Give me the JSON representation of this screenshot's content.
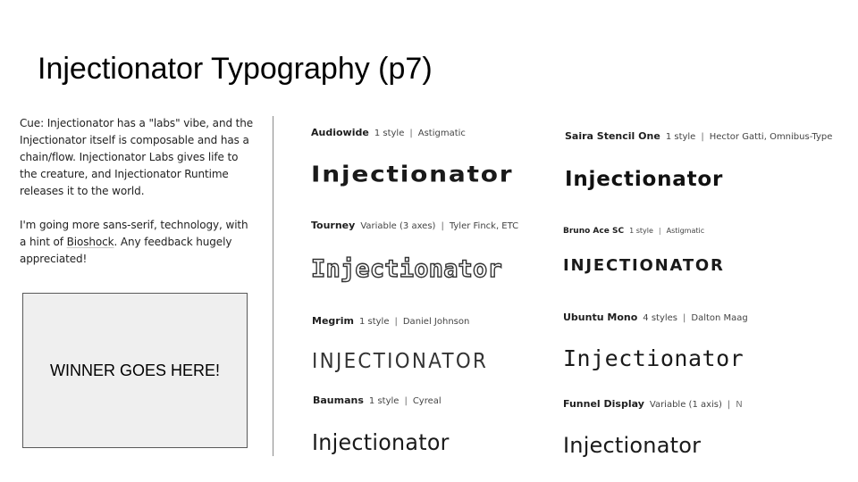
{
  "slide": {
    "title": "Injectionator Typography (p7)"
  },
  "cue": {
    "paragraph1": "Cue: Injectionator has a \"labs\" vibe, and the Injectionator itself is composable and has a chain/flow. Injectionator Labs gives life to the creature, and Injectionator Runtime releases it to the world.",
    "paragraph2_before_link": "I'm going more sans-serif, technology, with a hint of ",
    "paragraph2_link": "Bioshock",
    "paragraph2_after_link": ". Any feedback hugely appreciated!"
  },
  "winner": {
    "label": "WINNER GOES HERE!"
  },
  "fonts": [
    {
      "name": "Audiowide",
      "styles": "1 style",
      "designer": "Astigmatic",
      "sample": "Injectionator"
    },
    {
      "name": "Tourney",
      "styles": "Variable (3 axes)",
      "designer": "Tyler Finck, ETC",
      "sample": "Injectionator"
    },
    {
      "name": "Megrim",
      "styles": "1 style",
      "designer": "Daniel Johnson",
      "sample": "Injectionator"
    },
    {
      "name": "Baumans",
      "styles": "1 style",
      "designer": "Cyreal",
      "sample": "Injectionator"
    },
    {
      "name": "Saira Stencil One",
      "styles": "1 style",
      "designer": "Hector Gatti, Omnibus-Type",
      "sample": "Injectionator"
    },
    {
      "name": "Bruno Ace SC",
      "styles": "1 style",
      "designer": "Astigmatic",
      "sample": "Injectionator"
    },
    {
      "name": "Ubuntu Mono",
      "styles": "4 styles",
      "designer": "Dalton Maag",
      "sample": "Injectionator"
    },
    {
      "name": "Funnel Display",
      "styles": "Variable (1 axis)",
      "designer": "N",
      "sample": "Injectionator"
    }
  ],
  "separator": "|"
}
